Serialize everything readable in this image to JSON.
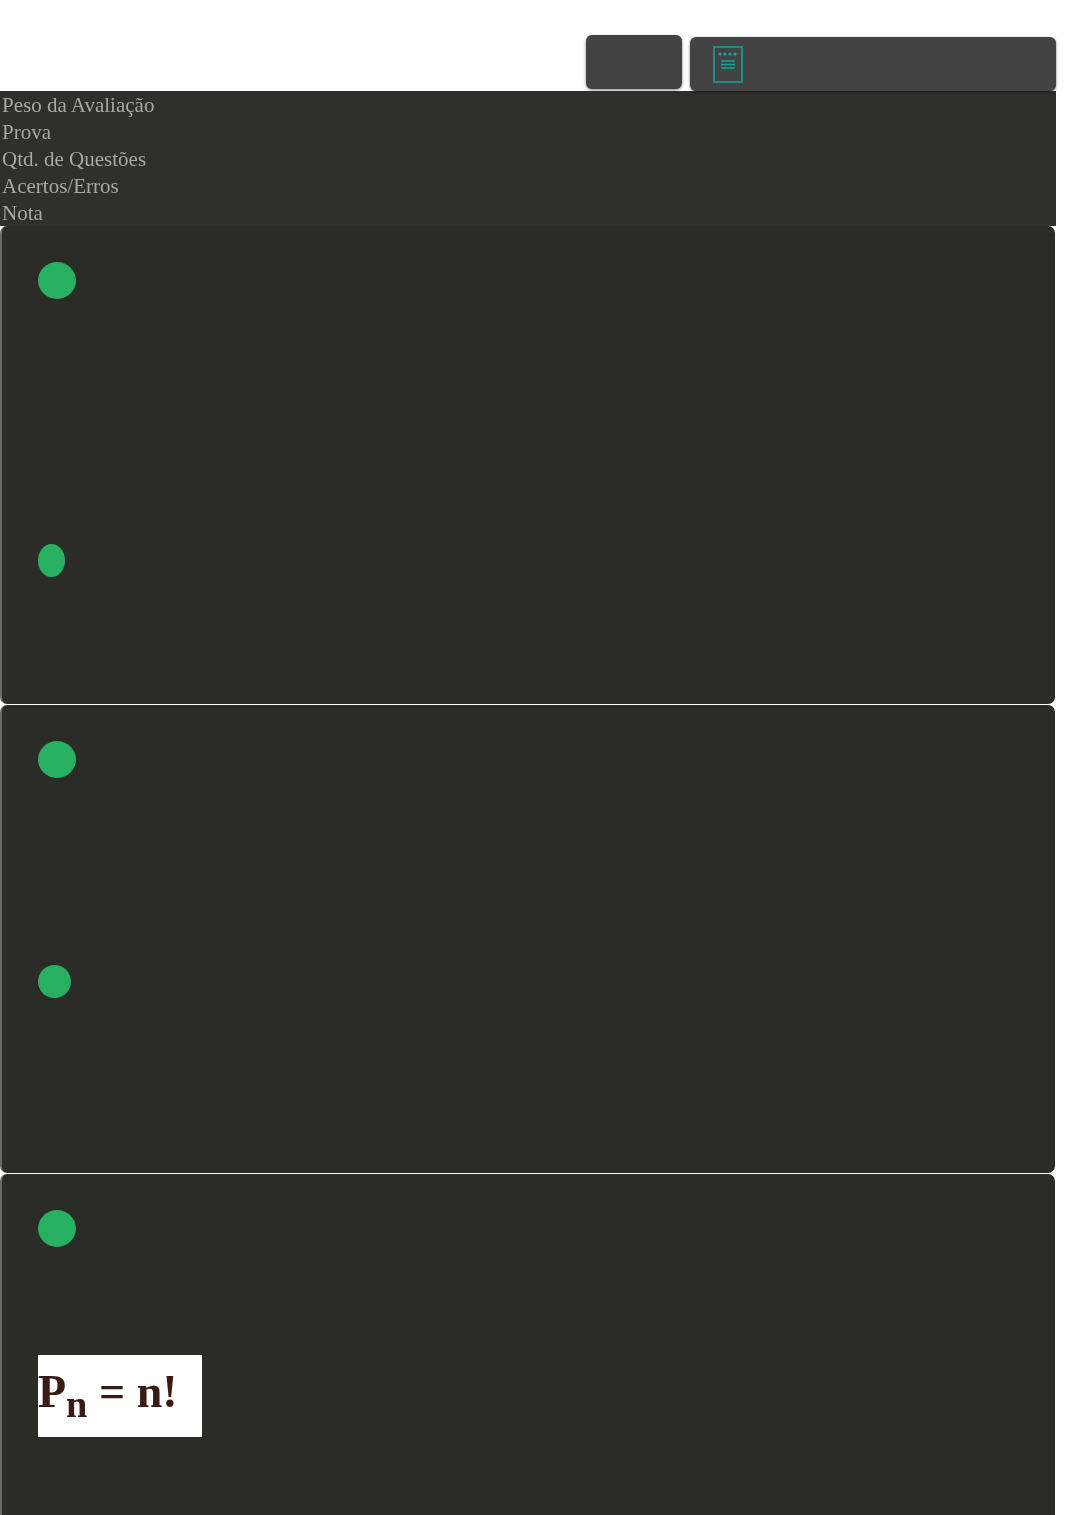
{
  "toolbar": {
    "buttons": [
      {
        "kind": "blank"
      },
      {
        "kind": "document"
      }
    ]
  },
  "summary": {
    "labels": [
      "Peso da Avaliação",
      "Prova",
      "Qtd. de Questões",
      "Acertos/Erros",
      "Nota"
    ]
  },
  "cards": [
    {
      "elements": [
        {
          "kind": "dot"
        },
        {
          "kind": "oval"
        }
      ]
    },
    {
      "elements": [
        {
          "kind": "dot"
        },
        {
          "kind": "small-dot"
        }
      ]
    },
    {
      "elements": [
        {
          "kind": "dot"
        },
        {
          "kind": "formula",
          "text": "P$_{n}$ = n!"
        }
      ]
    }
  ]
}
